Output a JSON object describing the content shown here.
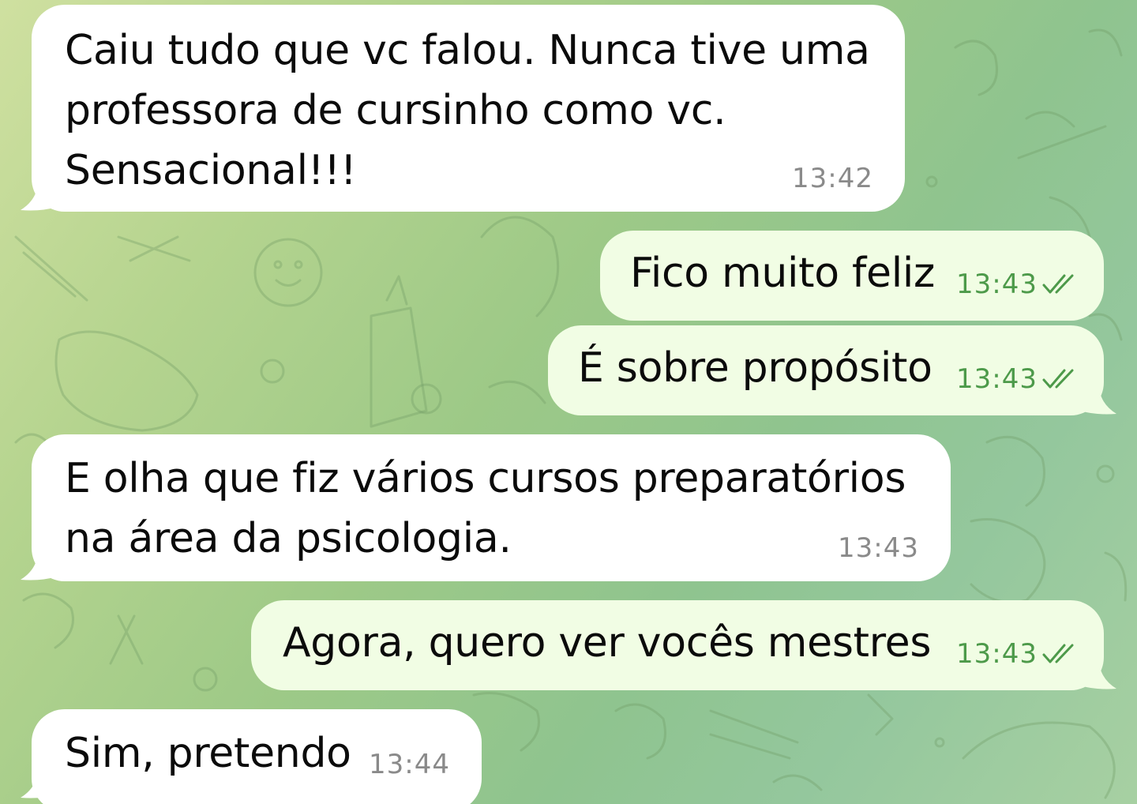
{
  "chat": {
    "theme": {
      "incoming_bubble": "#ffffff",
      "outgoing_bubble": "#f1fde4",
      "outgoing_meta": "#4d9a4a",
      "incoming_meta": "#8a8a8a"
    },
    "messages": [
      {
        "direction": "incoming",
        "text": "Caiu tudo que vc falou. Nunca tive uma\nprofessora de cursinho como vc.\nSensacional!!!",
        "time": "13:42",
        "status_icon": null
      },
      {
        "direction": "outgoing",
        "text": "Fico muito feliz",
        "time": "13:43",
        "status_icon": "double-check-icon"
      },
      {
        "direction": "outgoing",
        "text": "É sobre propósito",
        "time": "13:43",
        "status_icon": "double-check-icon"
      },
      {
        "direction": "incoming",
        "text": "E olha que fiz vários cursos preparatórios\nna área da psicologia.",
        "time": "13:43",
        "status_icon": null
      },
      {
        "direction": "outgoing",
        "text": "Agora, quero ver vocês mestres",
        "time": "13:43",
        "status_icon": "double-check-icon"
      },
      {
        "direction": "incoming",
        "text": "Sim, pretendo",
        "time": "13:44",
        "status_icon": null
      }
    ]
  }
}
